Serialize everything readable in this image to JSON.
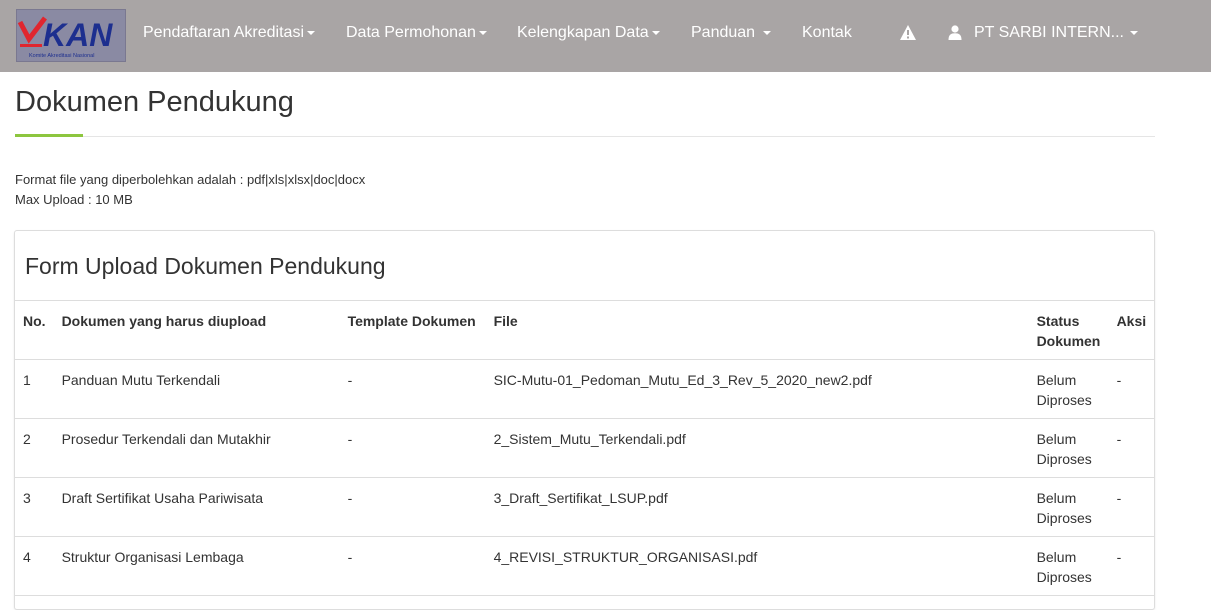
{
  "navbar": {
    "logo_text": "KAN",
    "logo_subtext": "Komite Akreditasi Nasional",
    "menu": [
      {
        "label": "Pendaftaran Akreditasi"
      },
      {
        "label": "Data Permohonan"
      },
      {
        "label": "Kelengkapan Data"
      },
      {
        "label": "Panduan"
      },
      {
        "label": "Kontak"
      }
    ],
    "user_name": "PT SARBI INTERN...",
    "colors": {
      "background": "#a9a5a5",
      "text": "#ffffff",
      "logo_red": "#e0262f",
      "logo_blue": "#1d2f8f"
    }
  },
  "page": {
    "title": "Dokumen Pendukung",
    "accent_color": "#8dc63f",
    "format_info": "Format file yang diperbolehkan adalah : pdf|xls|xlsx|doc|docx",
    "max_upload": "Max Upload : 10 MB"
  },
  "panel": {
    "title": "Form Upload Dokumen Pendukung",
    "columns": [
      "No.",
      "Dokumen yang harus diupload",
      "Template Dokumen",
      "File",
      "Status Dokumen",
      "Aksi"
    ],
    "rows": [
      {
        "no": "1",
        "document": "Panduan Mutu Terkendali",
        "template": "-",
        "file": "SIC-Mutu-01_Pedoman_Mutu_Ed_3_Rev_5_2020_new2.pdf",
        "status": "Belum Diproses",
        "action": "-"
      },
      {
        "no": "2",
        "document": "Prosedur Terkendali dan Mutakhir",
        "template": "-",
        "file": "2_Sistem_Mutu_Terkendali.pdf",
        "status": "Belum Diproses",
        "action": "-"
      },
      {
        "no": "3",
        "document": "Draft Sertifikat Usaha Pariwisata",
        "template": "-",
        "file": "3_Draft_Sertifikat_LSUP.pdf",
        "status": "Belum Diproses",
        "action": "-"
      },
      {
        "no": "4",
        "document": "Struktur Organisasi Lembaga",
        "template": "-",
        "file": "4_REVISI_STRUKTUR_ORGANISASI.pdf",
        "status": "Belum Diproses",
        "action": "-"
      }
    ]
  }
}
